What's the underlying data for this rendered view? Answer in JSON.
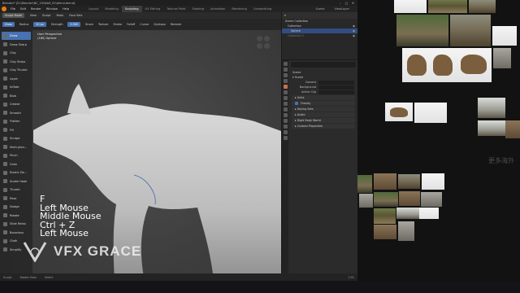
{
  "titlebar": {
    "title": "Blender* [D:\\Blender\\NC_10\\Wolf_01\\blend.blend]",
    "buttons": [
      "–",
      "□",
      "✕"
    ]
  },
  "menubar": {
    "items": [
      "File",
      "Edit",
      "Render",
      "Window",
      "Help"
    ],
    "workspaces": [
      "Layout",
      "Modeling",
      "Sculpting",
      "UV Editing",
      "Texture Paint",
      "Shading",
      "Animation",
      "Rendering",
      "Compositing"
    ],
    "active_workspace": "Sculpting",
    "scene_label": "Scene",
    "viewlayer_label": "ViewLayer"
  },
  "header2": {
    "mode": "Sculpt Mode",
    "menus": [
      "View",
      "Sculpt",
      "Mask",
      "Face Sets"
    ]
  },
  "header3": {
    "tool": "Draw",
    "radius_label": "Radius",
    "radius_value": "50 px",
    "strength_label": "Strength",
    "strength_value": "0.500",
    "extra": [
      "Brush",
      "Texture",
      "Stroke",
      "Falloff",
      "Cursor"
    ],
    "symmetry": "Dyntopo",
    "remesh": "Remesh"
  },
  "viewport": {
    "info_line1": "User Perspective",
    "info_line2": "(180) Sphere"
  },
  "tools": [
    "Draw",
    "Draw Sharp",
    "Clay",
    "Clay Strips",
    "Clay Thumb",
    "Layer",
    "Inflate",
    "Blob",
    "Crease",
    "Smooth",
    "Flatten",
    "Fill",
    "Scrape",
    "Multi-plan…",
    "Pinch",
    "Grab",
    "Elastic De…",
    "Snake Hook",
    "Thumb",
    "Pose",
    "Nudge",
    "Rotate",
    "Slide Relax",
    "Boundary",
    "Cloth",
    "Simplify"
  ],
  "active_tool": "Draw",
  "keys_overlay": [
    "F",
    "Left Mouse",
    "Middle Mouse",
    "Ctrl + Z",
    "Left Mouse"
  ],
  "watermark": {
    "brand": "VFX GRACE"
  },
  "outliner": {
    "rows": [
      {
        "label": "Scene Collection",
        "selected": false
      },
      {
        "label": "Collection",
        "selected": false
      },
      {
        "label": "Sphere",
        "selected": true
      },
      {
        "label": "Collection 2",
        "selected": false
      }
    ]
  },
  "properties": {
    "header": "Scene",
    "section_scene": "Scene",
    "camera_label": "Camera",
    "background_label": "Background",
    "active_clip_label": "Active Clip",
    "section_units": "Units",
    "gravity_label": "Gravity",
    "sections": [
      "Keying Sets",
      "Audio",
      "Rigid Body World",
      "Custom Properties"
    ]
  },
  "statusbar": {
    "items": [
      "Sculpt",
      "Rotate View",
      "Select"
    ],
    "version": "2.91"
  },
  "colors": {
    "active_tool": "#4772b3",
    "accent_orange": "#e87d0d",
    "selection": "#334d80"
  },
  "right_watermark": {
    "line1": "更多海外"
  }
}
